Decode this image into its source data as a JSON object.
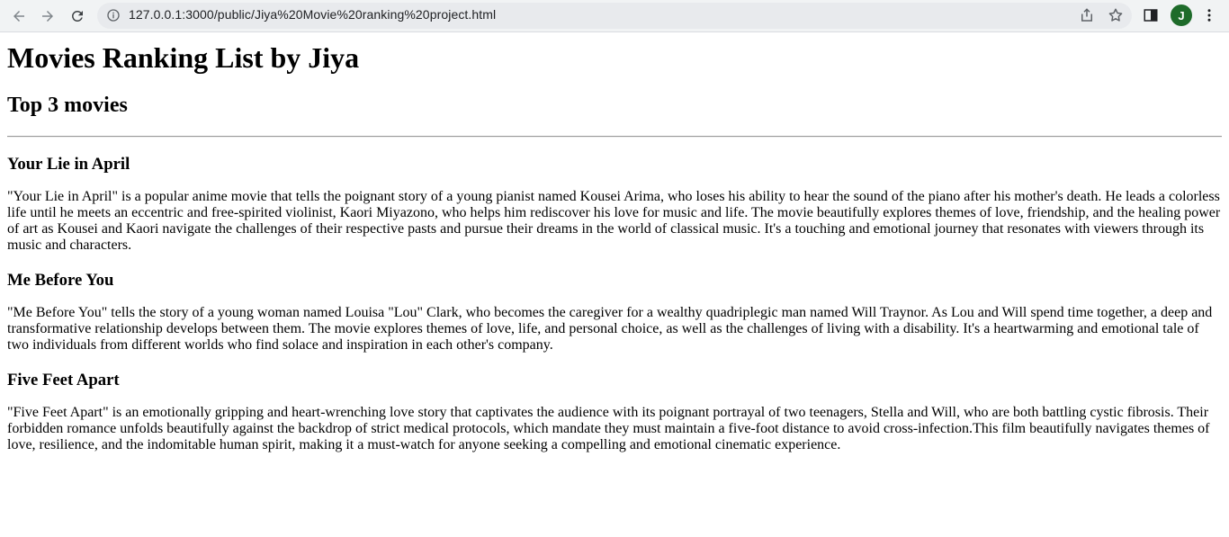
{
  "browser": {
    "url": "127.0.0.1:3000/public/Jiya%20Movie%20ranking%20project.html",
    "avatar_letter": "J",
    "accent_color": "#1e6b2a"
  },
  "page": {
    "title": "Movies Ranking List by Jiya",
    "subtitle": "Top 3 movies",
    "movies": [
      {
        "title": "Your Lie in April",
        "description": "\"Your Lie in April\" is a popular anime movie that tells the poignant story of a young pianist named Kousei Arima, who loses his ability to hear the sound of the piano after his mother's death. He leads a colorless life until he meets an eccentric and free-spirited violinist, Kaori Miyazono, who helps him rediscover his love for music and life. The movie beautifully explores themes of love, friendship, and the healing power of art as Kousei and Kaori navigate the challenges of their respective pasts and pursue their dreams in the world of classical music. It's a touching and emotional journey that resonates with viewers through its music and characters."
      },
      {
        "title": "Me Before You",
        "description": "\"Me Before You\" tells the story of a young woman named Louisa \"Lou\" Clark, who becomes the caregiver for a wealthy quadriplegic man named Will Traynor. As Lou and Will spend time together, a deep and transformative relationship develops between them. The movie explores themes of love, life, and personal choice, as well as the challenges of living with a disability. It's a heartwarming and emotional tale of two individuals from different worlds who find solace and inspiration in each other's company."
      },
      {
        "title": "Five Feet Apart",
        "description": "\"Five Feet Apart\" is an emotionally gripping and heart-wrenching love story that captivates the audience with its poignant portrayal of two teenagers, Stella and Will, who are both battling cystic fibrosis. Their forbidden romance unfolds beautifully against the backdrop of strict medical protocols, which mandate they must maintain a five-foot distance to avoid cross-infection.This film beautifully navigates themes of love, resilience, and the indomitable human spirit, making it a must-watch for anyone seeking a compelling and emotional cinematic experience."
      }
    ]
  }
}
